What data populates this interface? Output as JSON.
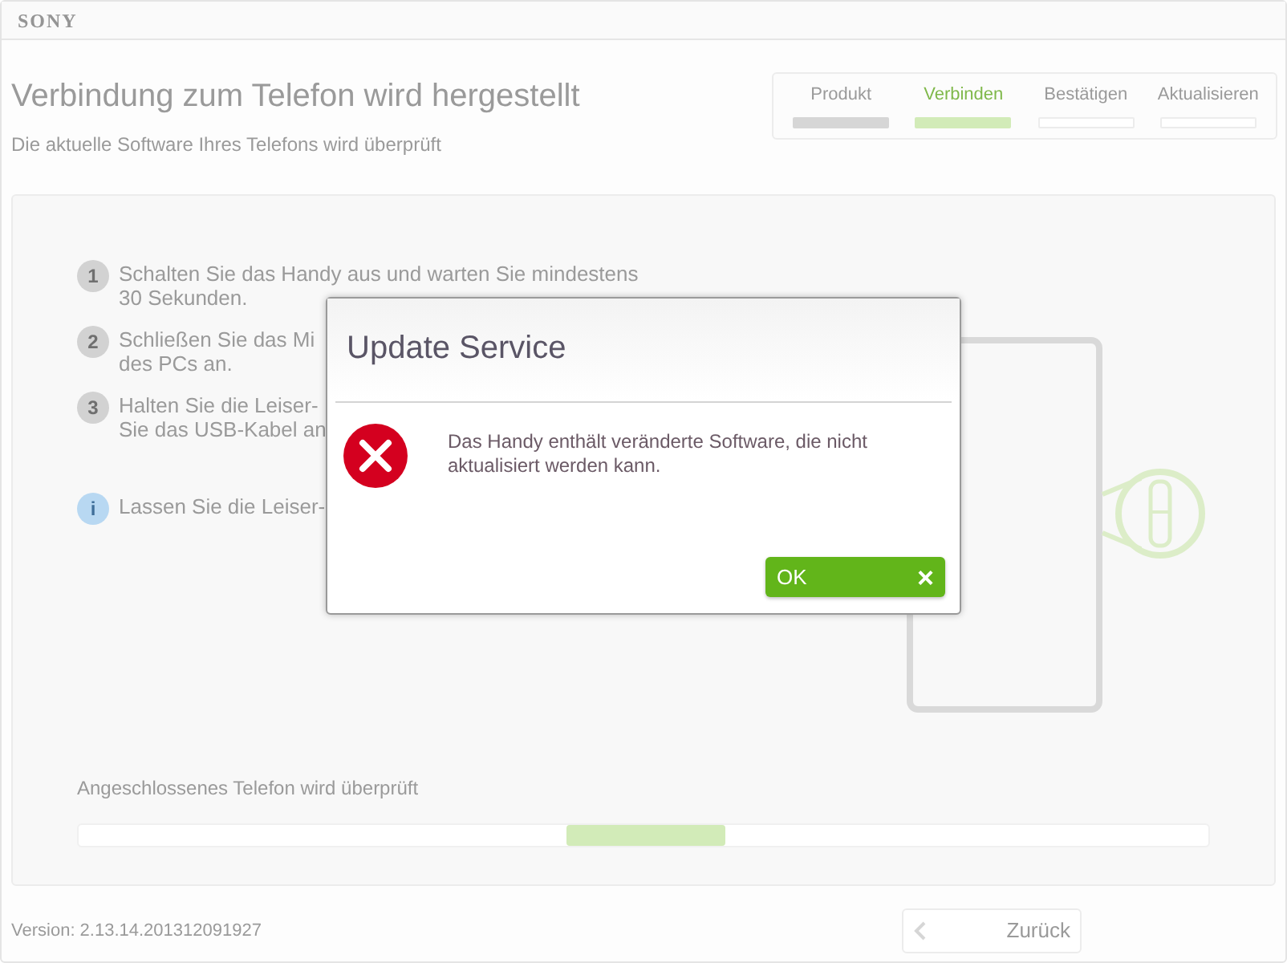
{
  "brand": "SONY",
  "title": "Verbindung zum Telefon wird hergestellt",
  "subtitle": "Die aktuelle Software Ihres Telefons wird überprüft",
  "progress_steps": [
    {
      "label": "Produkt",
      "completed": true,
      "selected": false
    },
    {
      "label": "Verbinden",
      "completed": false,
      "selected": true
    },
    {
      "label": "Bestätigen",
      "completed": false,
      "selected": false
    },
    {
      "label": "Aktualisieren",
      "completed": false,
      "selected": false
    }
  ],
  "instructions": [
    {
      "kind": "number",
      "marker": "1",
      "lines": [
        "Schalten Sie das Handy aus und warten Sie mindestens",
        "30 Sekunden."
      ]
    },
    {
      "kind": "number",
      "marker": "2",
      "lines": [
        "Schließen Sie das Mi",
        "des PCs an."
      ]
    },
    {
      "kind": "number",
      "marker": "3",
      "lines": [
        "Halten Sie die Leiser-",
        "Sie das USB-Kabel an"
      ]
    },
    {
      "kind": "info",
      "marker": "i",
      "lines": [
        "Lassen Sie die Leiser-"
      ]
    }
  ],
  "status_text": "Angeschlossenes Telefon wird überprüft",
  "version": "Version: 2.13.14.201312091927",
  "back_button": {
    "label": "Zurück"
  },
  "dialog": {
    "title": "Update Service",
    "message": "Das Handy enthält veränderte Software, die nicht aktualisiert werden kann.",
    "ok_button": {
      "label": "OK",
      "close": "×"
    }
  }
}
